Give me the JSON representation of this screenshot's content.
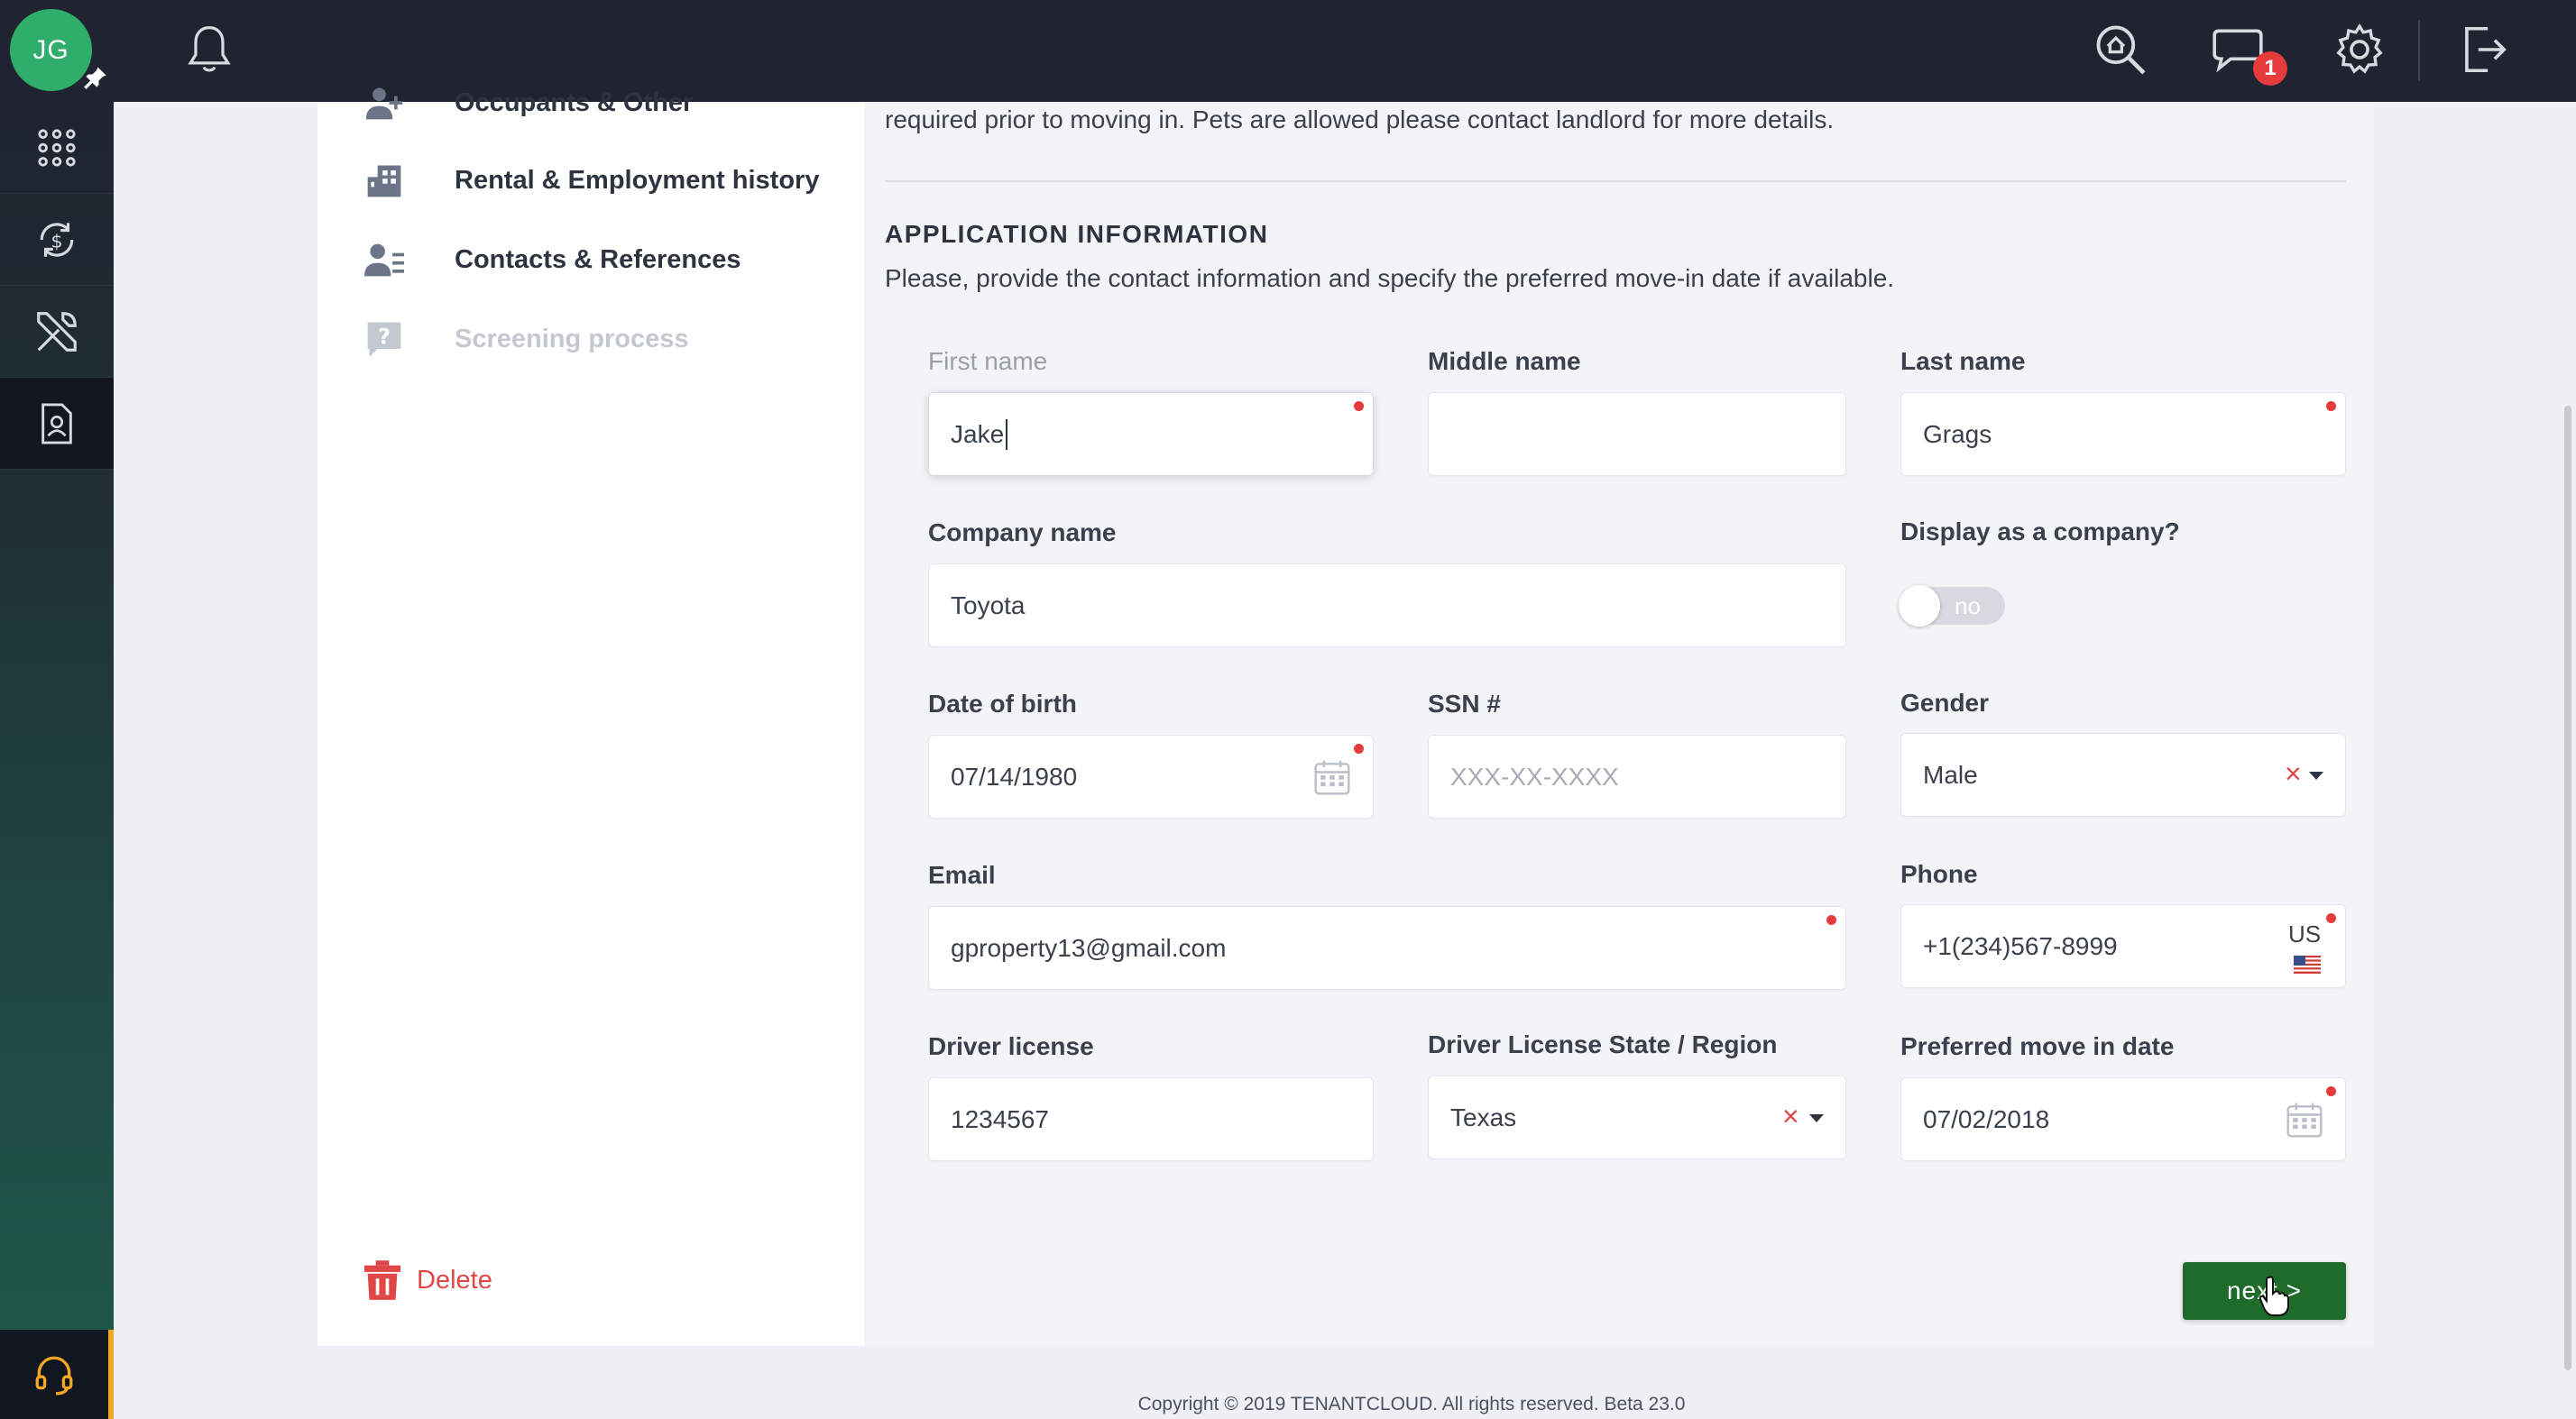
{
  "topbar": {
    "avatar_initials": "JG",
    "messages_badge": "1",
    "icons": [
      "pin-icon",
      "bell-icon",
      "search-home-icon",
      "chat-icon",
      "gear-icon",
      "logout-icon"
    ]
  },
  "sidebar": {
    "items": [
      "apps-grid-icon",
      "money-cycle-icon",
      "tools-icon",
      "tenant-document-icon"
    ],
    "bottom": "headset-icon"
  },
  "steps": {
    "occupants": "Occupants & Other",
    "rental": "Rental & Employment history",
    "contacts": "Contacts & References",
    "screening": "Screening process",
    "delete": "Delete"
  },
  "main": {
    "intro": "required prior to moving in. Pets are allowed please contact landlord for more details.",
    "section_title": "APPLICATION INFORMATION",
    "section_desc": "Please, provide the contact information and specify the preferred move-in date if available."
  },
  "form": {
    "first_name_label": "First name",
    "first_name_value": "Jake",
    "middle_name_label": "Middle name",
    "middle_name_value": "",
    "last_name_label": "Last name",
    "last_name_value": "Grags",
    "company_label": "Company name",
    "company_value": "Toyota",
    "display_company_label": "Display as a company?",
    "display_company_toggle": "no",
    "dob_label": "Date of birth",
    "dob_value": "07/14/1980",
    "ssn_label": "SSN #",
    "ssn_placeholder": "XXX-XX-XXXX",
    "gender_label": "Gender",
    "gender_value": "Male",
    "email_label": "Email",
    "email_value": "gproperty13@gmail.com",
    "phone_label": "Phone",
    "phone_value": "+1(234)567-8999",
    "phone_country": "US",
    "license_label": "Driver license",
    "license_value": "1234567",
    "license_state_label": "Driver License State / Region",
    "license_state_value": "Texas",
    "move_in_label": "Preferred move in date",
    "move_in_value": "07/02/2018"
  },
  "actions": {
    "next_label": "next >"
  },
  "footer": {
    "copyright": "Copyright © 2019 TENANTCLOUD. All rights reserved. Beta 23.0"
  },
  "colors": {
    "topbar": "#1f2430",
    "avatar": "#2eae6a",
    "next_button": "#1e6b2a",
    "required": "#e53b3b",
    "delete": "#e04848"
  }
}
